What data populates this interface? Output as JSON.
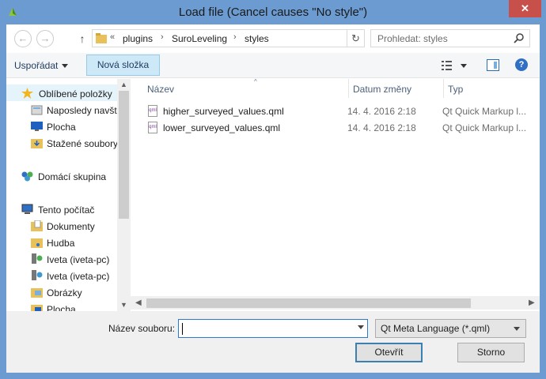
{
  "window": {
    "title": "Load file (Cancel causes \"No style\")",
    "close_label": "✕",
    "accent": "#6b9bd1"
  },
  "navbar": {
    "back_icon": "back-arrow-icon",
    "forward_icon": "forward-arrow-icon",
    "breadcrumb_overflow": "«",
    "breadcrumbs": [
      "plugins",
      "SuroLeveling",
      "styles"
    ],
    "search_placeholder": "Prohledat: styles"
  },
  "toolbar": {
    "organize_label": "Uspořádat",
    "new_folder_label": "Nová složka"
  },
  "sidebar": {
    "items": [
      {
        "label": "Oblíbené položky",
        "icon": "star-icon"
      },
      {
        "label": "Naposledy navštívené",
        "icon": "recent-places-icon"
      },
      {
        "label": "Plocha",
        "icon": "desktop-icon"
      },
      {
        "label": "Stažené soubory",
        "icon": "downloads-folder-icon"
      },
      {
        "label": "Domácí skupina",
        "icon": "homegroup-icon"
      },
      {
        "label": "Tento počítač",
        "icon": "computer-icon"
      },
      {
        "label": "Dokumenty",
        "icon": "documents-folder-icon"
      },
      {
        "label": "Hudba",
        "icon": "music-folder-icon"
      },
      {
        "label": "Iveta (iveta-pc)",
        "icon": "homegroup-user-icon"
      },
      {
        "label": "Iveta (iveta-pc)",
        "icon": "homegroup-user-icon"
      },
      {
        "label": "Obrázky",
        "icon": "pictures-folder-icon"
      },
      {
        "label": "Plocha",
        "icon": "desktop-folder-icon"
      }
    ]
  },
  "files": {
    "columns": [
      "Název",
      "Datum změny",
      "Typ"
    ],
    "rows": [
      {
        "name": "higher_surveyed_values.qml",
        "date": "14. 4. 2016 2:18",
        "type": "Qt Quick Markup l...",
        "icon_text": "qml"
      },
      {
        "name": "lower_surveyed_values.qml",
        "date": "14. 4. 2016 2:18",
        "type": "Qt Quick Markup l...",
        "icon_text": "qml"
      }
    ]
  },
  "bottom": {
    "filename_label": "Název souboru:",
    "filename_value": "",
    "filter_value": "Qt Meta Language (*.qml)",
    "open_label": "Otevřít",
    "cancel_label": "Storno"
  }
}
